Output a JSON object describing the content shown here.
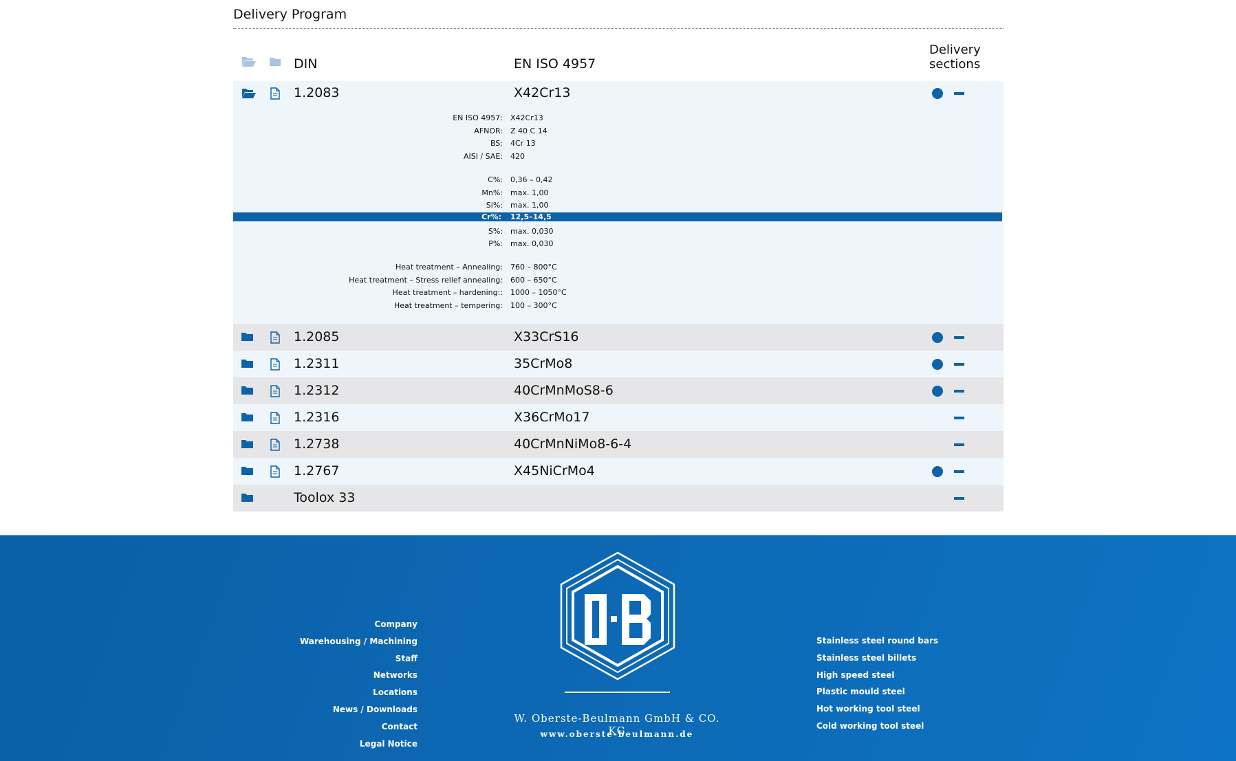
{
  "page": {
    "title": "Delivery Program"
  },
  "table": {
    "header": {
      "din": "DIN",
      "iso": "EN ISO 4957",
      "sections": "Delivery sections"
    },
    "expanded": {
      "din": "1.2083",
      "iso": "X42Cr13",
      "has_dot": true,
      "details": [
        {
          "label": "EN ISO 4957:",
          "value": "X42Cr13"
        },
        {
          "label": "AFNOR:",
          "value": "Z 40 C 14"
        },
        {
          "label": "BS:",
          "value": "4Cr 13"
        },
        {
          "label": "AISI / SAE:",
          "value": "420"
        },
        {
          "label": "C%:",
          "value": "0,36 – 0,42"
        },
        {
          "label": "Mn%:",
          "value": "max. 1,00"
        },
        {
          "label": "Si%:",
          "value": "max. 1,00"
        },
        {
          "label": "Cr%:",
          "value": "12,5–14,5"
        },
        {
          "label": "S%:",
          "value": "max. 0,030"
        },
        {
          "label": "P%:",
          "value": "max. 0,030"
        },
        {
          "label": "Heat treatment – Annealing:",
          "value": "760 – 800°C"
        },
        {
          "label": "Heat treatment – Stress relief annealing:",
          "value": "600 – 650°C"
        },
        {
          "label": "Heat treatment – hardening::",
          "value": "1000 – 1050°C"
        },
        {
          "label": "Heat treatment – tempering:",
          "value": "100 – 300°C"
        }
      ]
    },
    "rows": [
      {
        "din": "1.2085",
        "iso": "X33CrS16",
        "has_dot": true
      },
      {
        "din": "1.2311",
        "iso": "35CrMo8",
        "has_dot": true
      },
      {
        "din": "1.2312",
        "iso": "40CrMnMoS8-6",
        "has_dot": true
      },
      {
        "din": "1.2316",
        "iso": "X36CrMo17",
        "has_dot": false
      },
      {
        "din": "1.2738",
        "iso": "40CrMnNiMo8-6-4",
        "has_dot": false
      },
      {
        "din": "1.2767",
        "iso": "X45NiCrMo4",
        "has_dot": true
      },
      {
        "din": "Toolox 33",
        "iso": "",
        "has_dot": false
      }
    ]
  },
  "footer": {
    "left_links": [
      "Company",
      "Warehousing / Machining",
      "Staff",
      "Networks",
      "Locations",
      "News / Downloads",
      "Contact",
      "Legal Notice"
    ],
    "right_links": [
      "Stainless steel round bars",
      "Stainless steel billets",
      "High speed steel",
      "Plastic mould steel",
      "Hot working tool steel",
      "Cold working tool steel"
    ],
    "company": "W. Oberste-Beulmann GmbH & CO. KG",
    "website": "www.oberste-beulmann.de",
    "logo_text": "O·B"
  },
  "colors": {
    "accent": "#0e62a8",
    "row_light": "#eef6fc",
    "row_grey": "#e6e6e8",
    "footer": "#0d6ab6"
  },
  "icons": {
    "folder_open": "folder-open-icon",
    "folder": "folder-icon",
    "document": "document-icon",
    "delivery_dot": "delivery-dot-icon",
    "collapse": "minus-icon"
  }
}
